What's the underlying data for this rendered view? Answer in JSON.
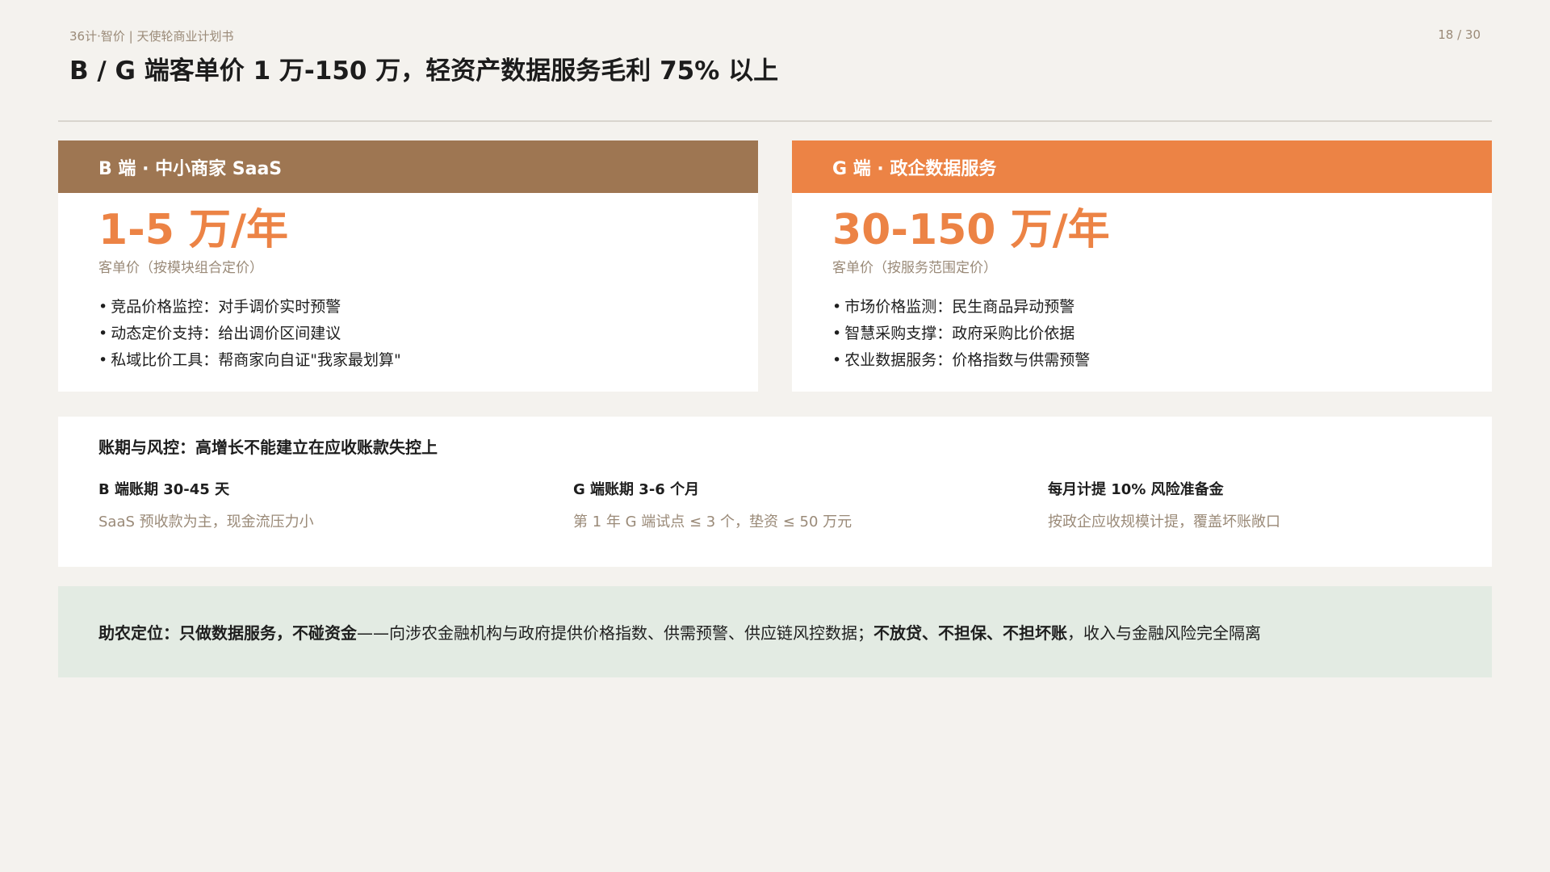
{
  "header": {
    "meta": "36计·智价 | 天使轮商业计划书",
    "page_number": "18 / 30",
    "title": "B / G 端客单价 1 万-150 万，轻资产数据服务毛利 75% 以上"
  },
  "cards": [
    {
      "header": "B 端 · 中小商家 SaaS",
      "price": "1-5 万/年",
      "price_note": "客单价（按模块组合定价）",
      "bullets": [
        "竞品价格监控：对手调价实时预警",
        "动态定价支持：给出调价区间建议",
        "私域比价工具：帮商家向自证\"我家最划算\""
      ]
    },
    {
      "header": "G 端 · 政企数据服务",
      "price": "30-150 万/年",
      "price_note": "客单价（按服务范围定价）",
      "bullets": [
        "市场价格监测：民生商品异动预警",
        "智慧采购支撑：政府采购比价依据",
        "农业数据服务：价格指数与供需预警"
      ]
    }
  ],
  "risk": {
    "title": "账期与风控：高增长不能建立在应收账款失控上",
    "columns": [
      {
        "title": "B 端账期 30-45 天",
        "desc": "SaaS 预收款为主，现金流压力小"
      },
      {
        "title": "G 端账期 3-6 个月",
        "desc": "第 1 年 G 端试点 ≤ 3 个，垫资 ≤ 50 万元"
      },
      {
        "title": "每月计提 10% 风险准备金",
        "desc": "按政企应收规模计提，覆盖坏账敞口"
      }
    ]
  },
  "positioning": {
    "bold_lead": "助农定位：只做数据服务，不碰资金",
    "text_mid": "——向涉农金融机构与政府提供价格指数、供需预警、供应链风控数据；",
    "bold_mid": "不放贷、不担保、不担坏账",
    "text_end": "，收入与金融风险完全隔离"
  },
  "colors": {
    "background": "#f4f2ee",
    "b_header": "#9e7652",
    "g_header": "#ec8345",
    "accent_price": "#ec8345",
    "muted_text": "#9a8a78",
    "positioning_bg": "#e3ebe3"
  }
}
